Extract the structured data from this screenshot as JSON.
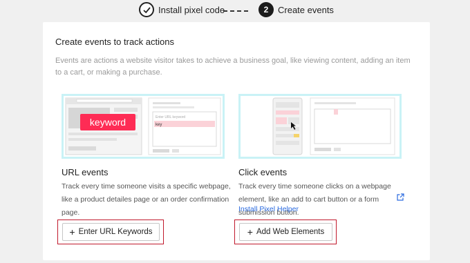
{
  "stepper": {
    "step1_label": "Install pixel code",
    "step2_number": "2",
    "step2_label": "Create events"
  },
  "card": {
    "title": "Create events to track actions",
    "description": "Events are actions a website visitor takes to achieve a business goal, like viewing content, adding an item to a cart, or making a purchase."
  },
  "url_events": {
    "title": "URL events",
    "description": "Track every time someone visits a specific webpage, like a product detailes page or an order confirmation page.",
    "illustration": {
      "keyword_badge": "keyword",
      "field_placeholder": "Enter URL keyword",
      "field_value": "key"
    },
    "button_label": "Enter URL Keywords",
    "button_icon": "plus-icon"
  },
  "click_events": {
    "title": "Click events",
    "description": "Track every time someone clicks on a webpage element, like an add to cart button or a form submission button.",
    "helper_link": "Install Pixel Helper",
    "link_icon": "external-link-icon",
    "button_label": "Add Web Elements",
    "button_icon": "plus-icon"
  },
  "colors": {
    "accent_pink": "#fe2c55",
    "highlight_cyan": "#c9f2f6",
    "frame_red": "#c0182b",
    "link_blue": "#2b6be0"
  }
}
